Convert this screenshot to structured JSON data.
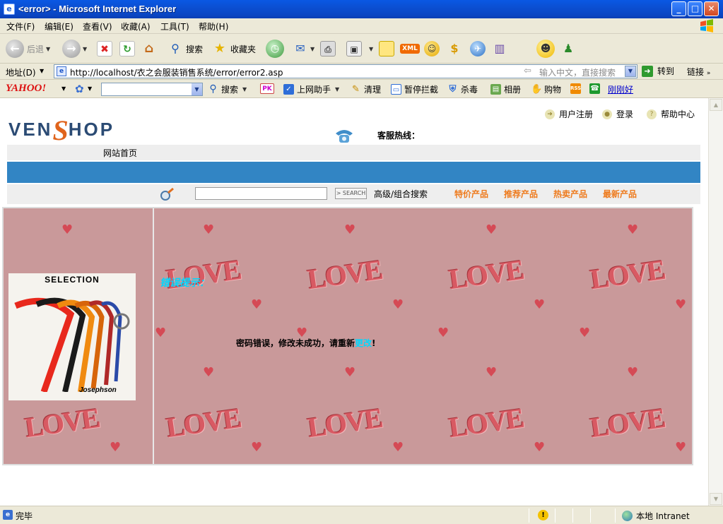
{
  "window": {
    "title": "<error> - Microsoft Internet Explorer",
    "minimize": "_",
    "maximize": "□",
    "close": "✕"
  },
  "menu": {
    "items": [
      "文件(F)",
      "编辑(E)",
      "查看(V)",
      "收藏(A)",
      "工具(T)",
      "帮助(H)"
    ]
  },
  "toolbar": {
    "back_label": "后退",
    "search_label": "搜索",
    "favorites_label": "收藏夹",
    "xml_badge": "XML"
  },
  "address": {
    "label": "地址(D)",
    "url": "http://localhost/衣之会服装销售系统/error/error2.asp",
    "search_hint": "输入中文，直接搜索",
    "go_label": "转到",
    "links_label": "链接"
  },
  "yahoo_bar": {
    "logo": "YAHOO!",
    "search_label": "搜索",
    "pk_badge": "PK",
    "items": [
      "上网助手",
      "清理",
      "暂停拦截",
      "杀毒",
      "相册",
      "购物"
    ],
    "link": "刚刚好"
  },
  "site": {
    "logo_left": "VEN",
    "logo_s": "S",
    "logo_right": "HOP",
    "top_links": [
      "用户注册",
      "登录",
      "帮助中心"
    ],
    "hotline": "客服热线：",
    "nav_home": "网站首页",
    "search_button": "> SEARCH",
    "advanced_search": "高级/组合搜索",
    "categories": [
      "特价产品",
      "推荐产品",
      "热卖产品",
      "最新产品"
    ]
  },
  "product_image": {
    "heading": "SELECTION",
    "brand": "Josephson"
  },
  "background_pattern": {
    "word": "LOVE",
    "heart": "♥"
  },
  "error": {
    "title": "错误提示：",
    "message_before": "密码错误，修改未成功，请重新",
    "message_link": "更改",
    "message_after": "!"
  },
  "status": {
    "text": "完毕",
    "zone": "本地 Intranet"
  },
  "colors": {
    "accent_blue": "#3285c4",
    "category_orange": "#ee7a1c",
    "error_cyan": "#00d8ff",
    "love_background": "#c9999a"
  }
}
